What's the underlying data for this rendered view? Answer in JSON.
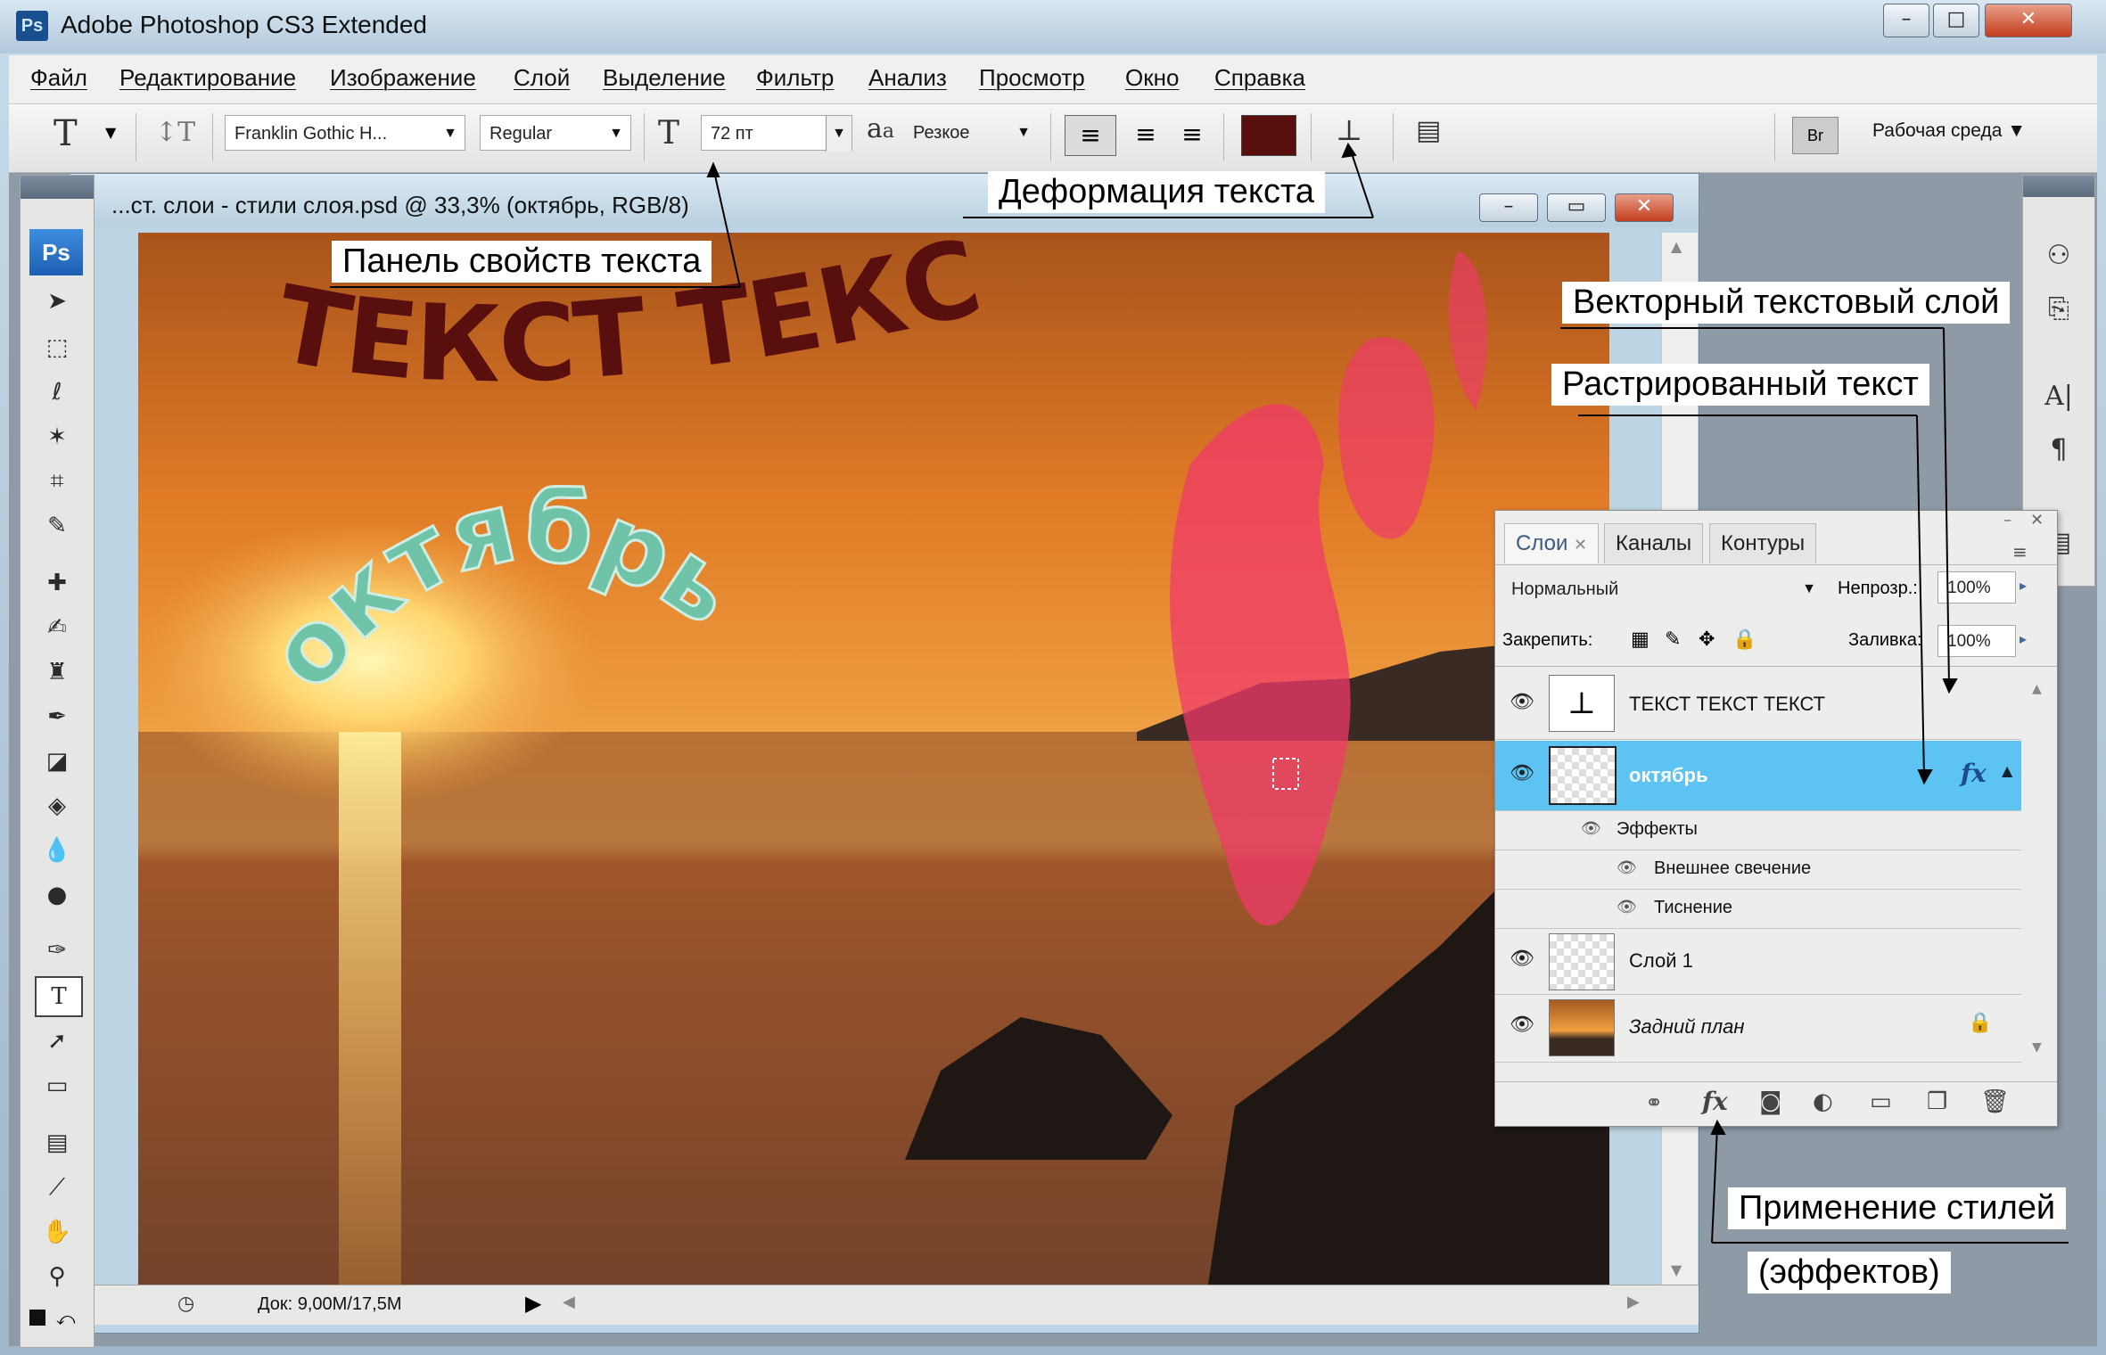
{
  "app": {
    "icon_label": "Ps",
    "title": "Adobe Photoshop CS3 Extended"
  },
  "menu": [
    "Файл",
    "Редактирование",
    "Изображение",
    "Слой",
    "Выделение",
    "Фильтр",
    "Анализ",
    "Просмотр",
    "Окно",
    "Справка"
  ],
  "options": {
    "font_family": "Franklin Gothic H...",
    "font_style": "Regular",
    "font_size": "72 пт",
    "antialias_label": "a",
    "antialias_label_sub": "a",
    "antialias": "Резкое",
    "text_color": "#5a0f0f",
    "workspace": "Рабочая среда"
  },
  "document": {
    "title": "...ст. слои - стили слоя.psd @ 33,3% (октябрь, RGB/8)",
    "status": "Док: 9,00М/17,5М",
    "headline_text": "ТЕКСТ ТЕКСТ ТЕКСТ",
    "arc_text": "октябрь"
  },
  "toolbox": {
    "logo": "Ps"
  },
  "layers_panel": {
    "tabs": [
      "Слои",
      "Каналы",
      "Контуры"
    ],
    "blend_mode": "Нормальный",
    "opacity_label": "Непрозр.:",
    "opacity": "100%",
    "lock_label": "Закрепить:",
    "fill_label": "Заливка:",
    "fill": "100%",
    "layers": [
      {
        "name": "ТЕКСТ ТЕКСТ ТЕКСТ",
        "type": "text",
        "selected": false
      },
      {
        "name": "октябрь",
        "type": "raster",
        "selected": true,
        "fx": "fx"
      },
      {
        "name": "Эффекты",
        "type": "effects"
      },
      {
        "name": "Внешнее свечение",
        "type": "effect"
      },
      {
        "name": "Тиснение",
        "type": "effect"
      },
      {
        "name": "Слой 1",
        "type": "raster",
        "selected": false
      },
      {
        "name": "Задний план",
        "type": "background",
        "selected": false
      }
    ],
    "footer_fx": "fx"
  },
  "callouts": {
    "text_props": "Панель свойств текста",
    "warp": "Деформация текста",
    "vector_layer": "Векторный текстовый слой",
    "rasterized": "Растрированный текст",
    "styles_1": "Применение стилей",
    "styles_2": "(эффектов)"
  },
  "colors": {
    "selected_layer": "#5cc3f2",
    "headline": "#5a0f0f",
    "arc_text": "#6fc3a9"
  }
}
